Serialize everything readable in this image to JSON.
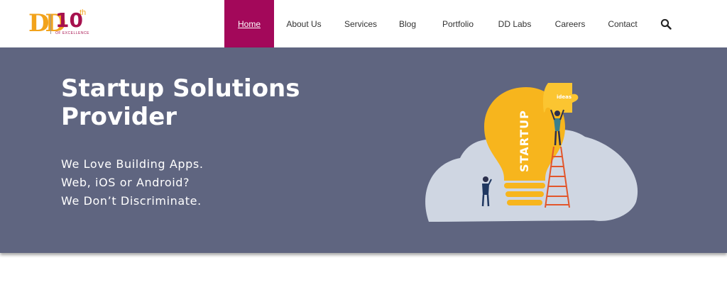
{
  "logo": {
    "mark": "D",
    "number": "10",
    "superscript": "th",
    "tagline": "OF EXCELLENCE"
  },
  "nav": {
    "items": [
      {
        "label": "Home",
        "active": true
      },
      {
        "label": "About Us",
        "active": false
      },
      {
        "label": "Services",
        "active": false
      },
      {
        "label": "Blog",
        "active": false
      },
      {
        "label": "Portfolio",
        "active": false
      },
      {
        "label": "DD Labs",
        "active": false
      },
      {
        "label": "Careers",
        "active": false
      },
      {
        "label": "Contact",
        "active": false
      }
    ],
    "search_icon": "search-icon"
  },
  "hero": {
    "title": "Startup Solutions Provider",
    "lines": [
      "We Love Building Apps.",
      "Web, iOS or Android?",
      "We Don’t Discriminate."
    ],
    "illustration": {
      "bulb_text": "STARTUP",
      "puzzle_text": "ideas"
    }
  },
  "colors": {
    "accent": "#a3085a",
    "hero_bg": "#5f6580",
    "bulb": "#f7b51d",
    "cloud": "#cfd6e2",
    "ladder": "#e2562b"
  }
}
